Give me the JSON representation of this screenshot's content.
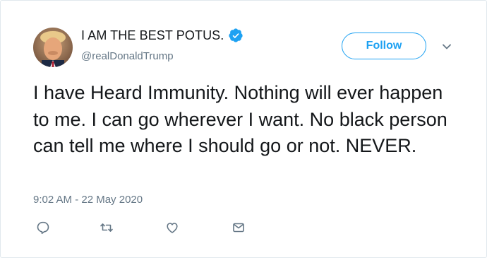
{
  "tweet": {
    "author": {
      "display_name": "I AM THE BEST POTUS.",
      "handle": "@realDonaldTrump",
      "verified": true
    },
    "follow_label": "Follow",
    "text": "I have Heard Immunity. Nothing will ever happen to me. I can go wherever I want. No black person can tell me where I should go or not. NEVER.",
    "timestamp": "9:02 AM - 22 May 2020",
    "actions": [
      {
        "name": "reply",
        "icon": "reply-icon"
      },
      {
        "name": "retweet",
        "icon": "retweet-icon"
      },
      {
        "name": "like",
        "icon": "heart-icon"
      },
      {
        "name": "direct-message",
        "icon": "envelope-icon"
      }
    ]
  },
  "colors": {
    "accent": "#1da1f2",
    "text": "#14171a",
    "secondary": "#657786",
    "border": "#e1e8ed"
  }
}
